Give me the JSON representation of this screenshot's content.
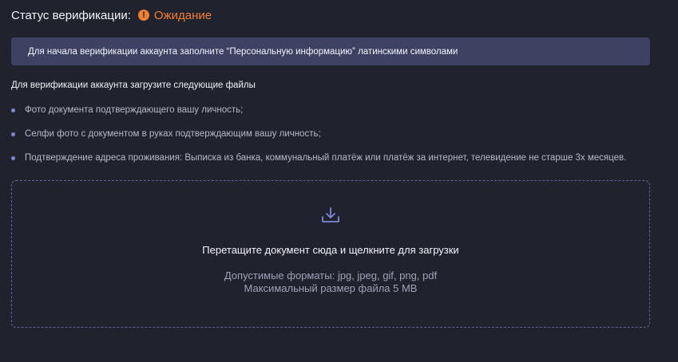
{
  "status": {
    "label": "Статус верификации:",
    "icon": "exclamation-icon",
    "value": "Ожидание",
    "color": "#f07f33"
  },
  "notice": {
    "text": "Для начала верификации аккаунта заполните “Персональную информацию” латинскими символами"
  },
  "requirements": {
    "title": "Для верификации аккаунта загрузите следующие файлы",
    "items": [
      "Фото документа подтверждающего вашу личность;",
      "Селфи фото с документом в руках подтверждающим вашу личность;",
      "Подтверждение адреса проживания: Выписка из банка, коммунальный платёж или платёж за интернет, телевидение не старше 3х месяцев."
    ]
  },
  "dropzone": {
    "icon": "download-icon",
    "title": "Перетащите документ сюда и щелкните для загрузки",
    "formats": "Допустимые форматы: jpg, jpeg, gif, png, pdf",
    "max_size": "Максимальный размер файла 5 MB"
  },
  "colors": {
    "background": "#20222d",
    "notice_background": "#3d4262",
    "accent": "#7c86dc",
    "warning": "#f07f33"
  }
}
